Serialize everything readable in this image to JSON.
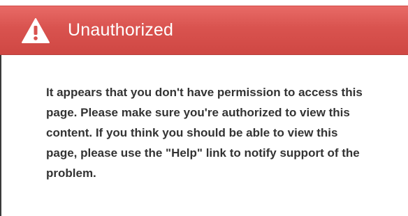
{
  "dialog": {
    "title": "Unauthorized",
    "icon": "warning-triangle-icon",
    "header_color": "#d9534f",
    "message": "It appears that you don't have permission to access this page. Please make sure you're authorized to view this content. If you think you should be able to view this page, please use the \"Help\" link to notify support of the problem."
  }
}
